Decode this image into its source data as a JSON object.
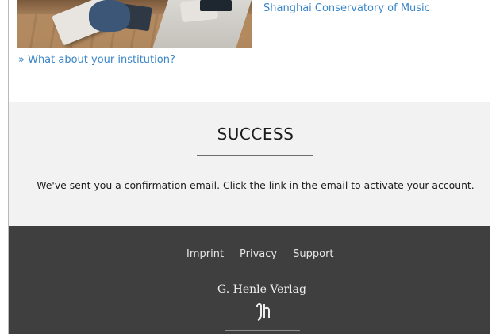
{
  "institution_link": "Shanghai Conservatory of Music",
  "more_link": "» What about your institution?",
  "success": {
    "title": "SUCCESS",
    "message": "We've sent you a confirmation email. Click the link in the email to activate your account."
  },
  "footer": {
    "nav": [
      "Imprint",
      "Privacy",
      "Support"
    ],
    "brand_name": "G. Henle Verlag"
  },
  "colors": {
    "link": "#3a86c8",
    "success_bg": "#f2f2f2",
    "footer_bg": "#3f3f3f"
  }
}
